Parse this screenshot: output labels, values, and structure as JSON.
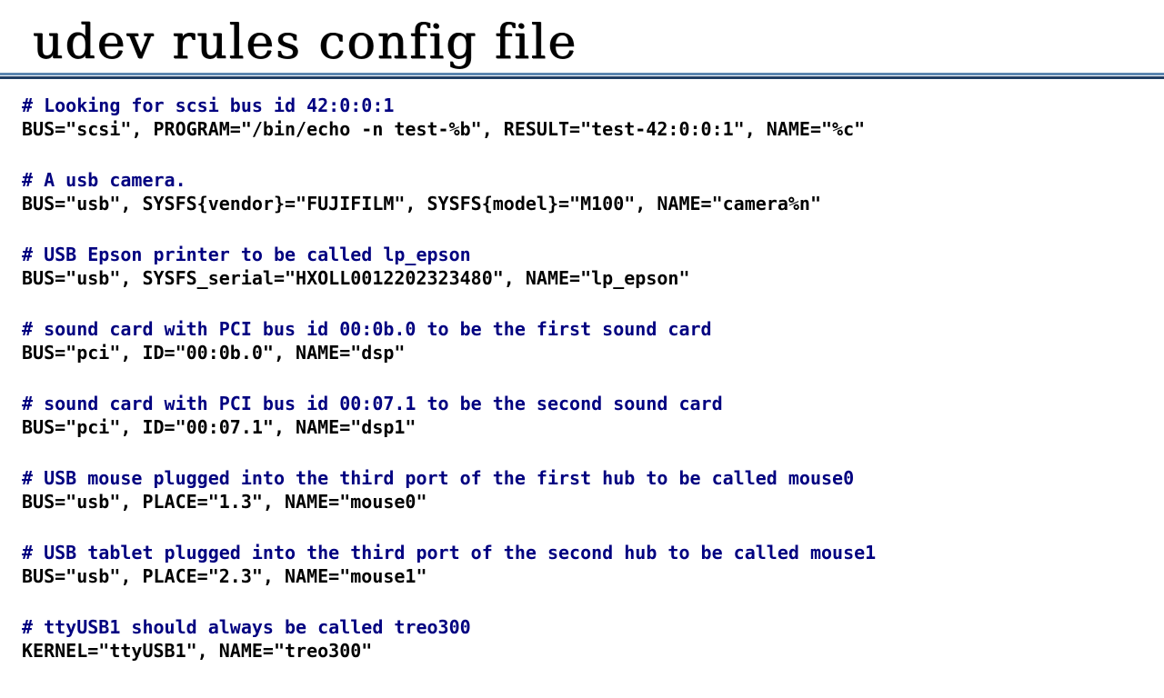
{
  "title": "udev rules config file",
  "colors": {
    "comment": "#000080",
    "code": "#000000",
    "rule_top": "#5b86b0",
    "rule_bottom": "#1f3d63"
  },
  "blocks": [
    {
      "comment": "# Looking for scsi bus id 42:0:0:1",
      "rule": "BUS=\"scsi\", PROGRAM=\"/bin/echo -n test-%b\", RESULT=\"test-42:0:0:1\", NAME=\"%c\""
    },
    {
      "comment": "# A usb camera.",
      "rule": "BUS=\"usb\", SYSFS{vendor}=\"FUJIFILM\", SYSFS{model}=\"M100\", NAME=\"camera%n\""
    },
    {
      "comment": "# USB Epson printer to be called lp_epson",
      "rule": "BUS=\"usb\", SYSFS_serial=\"HXOLL0012202323480\", NAME=\"lp_epson\""
    },
    {
      "comment": "# sound card with PCI bus id 00:0b.0 to be the first sound card",
      "rule": "BUS=\"pci\", ID=\"00:0b.0\", NAME=\"dsp\""
    },
    {
      "comment": "# sound card with PCI bus id 00:07.1 to be the second sound card",
      "rule": "BUS=\"pci\", ID=\"00:07.1\", NAME=\"dsp1\""
    },
    {
      "comment": "# USB mouse plugged into the third port of the first hub to be called mouse0",
      "rule": "BUS=\"usb\", PLACE=\"1.3\", NAME=\"mouse0\""
    },
    {
      "comment": "# USB tablet plugged into the third port of the second hub to be called mouse1",
      "rule": "BUS=\"usb\", PLACE=\"2.3\", NAME=\"mouse1\""
    },
    {
      "comment": "# ttyUSB1 should always be called treo300",
      "rule": "KERNEL=\"ttyUSB1\", NAME=\"treo300\""
    }
  ]
}
